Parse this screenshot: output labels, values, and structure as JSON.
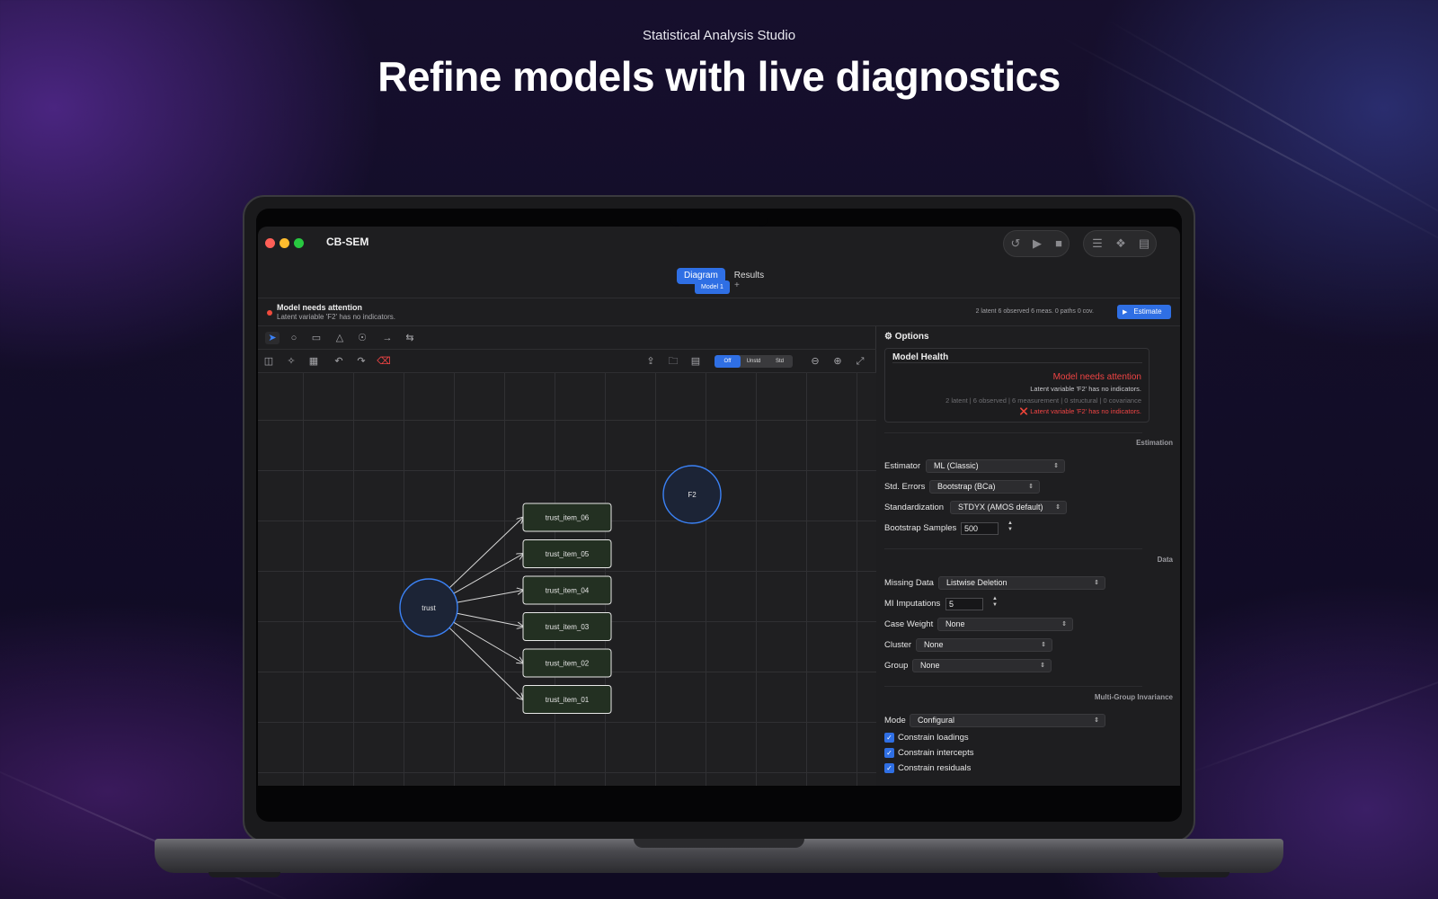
{
  "hero": {
    "eyebrow": "Statistical Analysis Studio",
    "headline": "Refine models with live diagnostics"
  },
  "colors": {
    "accent": "#2f6fe4",
    "danger": "#ef4444",
    "node_border": "#3b82f6",
    "indicator_fill": "#233022"
  },
  "app": {
    "title": "CB-SEM",
    "window_controls": [
      "close",
      "minimize",
      "zoom"
    ],
    "toolbar_icons": [
      "reset-icon",
      "run-icon",
      "stop-icon",
      "settings-sliders-icon",
      "diagram-network-icon",
      "report-icon"
    ]
  },
  "view_tabs": [
    {
      "label": "Diagram",
      "active": true
    },
    {
      "label": "Results",
      "active": false
    }
  ],
  "model_tabs": {
    "items": [
      {
        "label": "Model 1",
        "active": true
      }
    ],
    "add_label": "+"
  },
  "attention": {
    "title": "Model needs attention",
    "detail": "Latent variable 'F2' has no indicators.",
    "stats": "2 latent  6 observed  6 meas.  0 paths  0 cov.",
    "estimate_label": "Estimate"
  },
  "draw_tools": [
    "select-pointer-icon",
    "latent-circle-icon",
    "observed-rect-icon",
    "triangle-icon",
    "error-term-icon",
    "path-arrow-icon",
    "covariance-arrow-icon"
  ],
  "edit_tools": [
    "auto-layout-icon",
    "magic-wand-icon",
    "grid-icon",
    "undo-icon",
    "redo-icon",
    "delete-icon"
  ],
  "file_tools": [
    "export-icon",
    "open-folder-icon",
    "document-icon"
  ],
  "estimates_view": {
    "options": [
      "Off",
      "Unstd",
      "Std"
    ],
    "selected": "Off"
  },
  "zoom_tools": [
    "zoom-out-icon",
    "zoom-in-icon",
    "fit-icon"
  ],
  "diagram": {
    "latent": [
      {
        "id": "trust",
        "label": "trust"
      },
      {
        "id": "F2",
        "label": "F2"
      }
    ],
    "indicators": [
      {
        "label": "trust_item_06"
      },
      {
        "label": "trust_item_05"
      },
      {
        "label": "trust_item_04"
      },
      {
        "label": "trust_item_03"
      },
      {
        "label": "trust_item_02"
      },
      {
        "label": "trust_item_01"
      }
    ],
    "paths": [
      {
        "from": "trust",
        "to": "trust_item_06"
      },
      {
        "from": "trust",
        "to": "trust_item_05"
      },
      {
        "from": "trust",
        "to": "trust_item_04"
      },
      {
        "from": "trust",
        "to": "trust_item_03"
      },
      {
        "from": "trust",
        "to": "trust_item_02"
      },
      {
        "from": "trust",
        "to": "trust_item_01"
      }
    ]
  },
  "options": {
    "header": "Options",
    "health": {
      "title": "Model Health",
      "status": "Model needs attention",
      "message": "Latent variable 'F2' has no indicators.",
      "counts": "2 latent | 6 observed | 6 measurement | 0 structural | 0 covariance",
      "issue": "Latent variable 'F2' has no indicators."
    },
    "estimation": {
      "section": "Estimation",
      "estimator_label": "Estimator",
      "estimator_value": "ML (Classic)",
      "std_errors_label": "Std. Errors",
      "std_errors_value": "Bootstrap (BCa)",
      "standardization_label": "Standardization",
      "standardization_value": "STDYX (AMOS default)",
      "bootstrap_label": "Bootstrap Samples",
      "bootstrap_value": "500"
    },
    "data": {
      "section": "Data",
      "missing_label": "Missing Data",
      "missing_value": "Listwise Deletion",
      "mi_label": "MI Imputations",
      "mi_value": "5",
      "weight_label": "Case Weight",
      "weight_value": "None",
      "cluster_label": "Cluster",
      "cluster_value": "None",
      "group_label": "Group",
      "group_value": "None"
    },
    "invariance": {
      "section": "Multi-Group Invariance",
      "mode_label": "Mode",
      "mode_value": "Configural",
      "constraints": [
        {
          "label": "Constrain loadings",
          "checked": true
        },
        {
          "label": "Constrain intercepts",
          "checked": true
        },
        {
          "label": "Constrain residuals",
          "checked": true
        }
      ]
    }
  }
}
